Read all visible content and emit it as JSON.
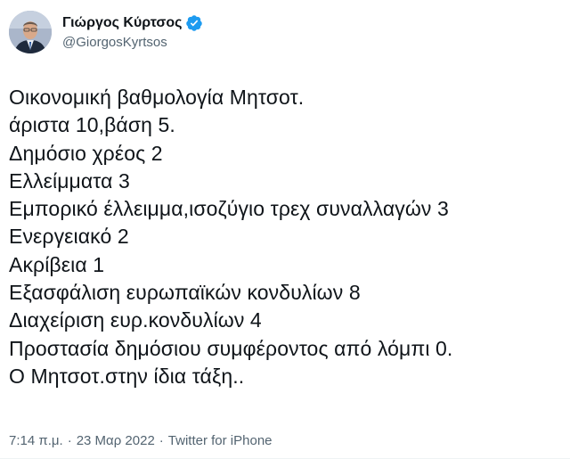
{
  "author": {
    "display_name": "Γιώργος Κύρτσος",
    "handle": "@GiorgosKyrtsos",
    "verified": true
  },
  "tweet": {
    "lines": [
      "Οικονομική βαθμολογία Μητσοτ.",
      "άριστα 10,βάση 5.",
      "Δημόσιο χρέος 2",
      "Ελλείμματα 3",
      "Εμπορικό έλλειμμα,ισοζύγιο τρεχ συναλλαγών 3",
      "Ενεργειακό 2",
      "Ακρίβεια 1",
      "Εξασφάλιση ευρωπαϊκών κονδυλίων 8",
      "Διαχείριση ευρ.κονδυλίων 4",
      "Προστασία δημόσιου συμφέροντος από λόμπι 0.",
      "Ο Μητσοτ.στην ίδια τάξη.."
    ]
  },
  "meta": {
    "time": "7:14 π.μ.",
    "separator": "·",
    "date": "23 Μαρ 2022",
    "source": "Twitter for iPhone"
  },
  "colors": {
    "verified_badge": "#1d9bf0",
    "secondary_text": "#536471",
    "primary_text": "#0f1419"
  }
}
